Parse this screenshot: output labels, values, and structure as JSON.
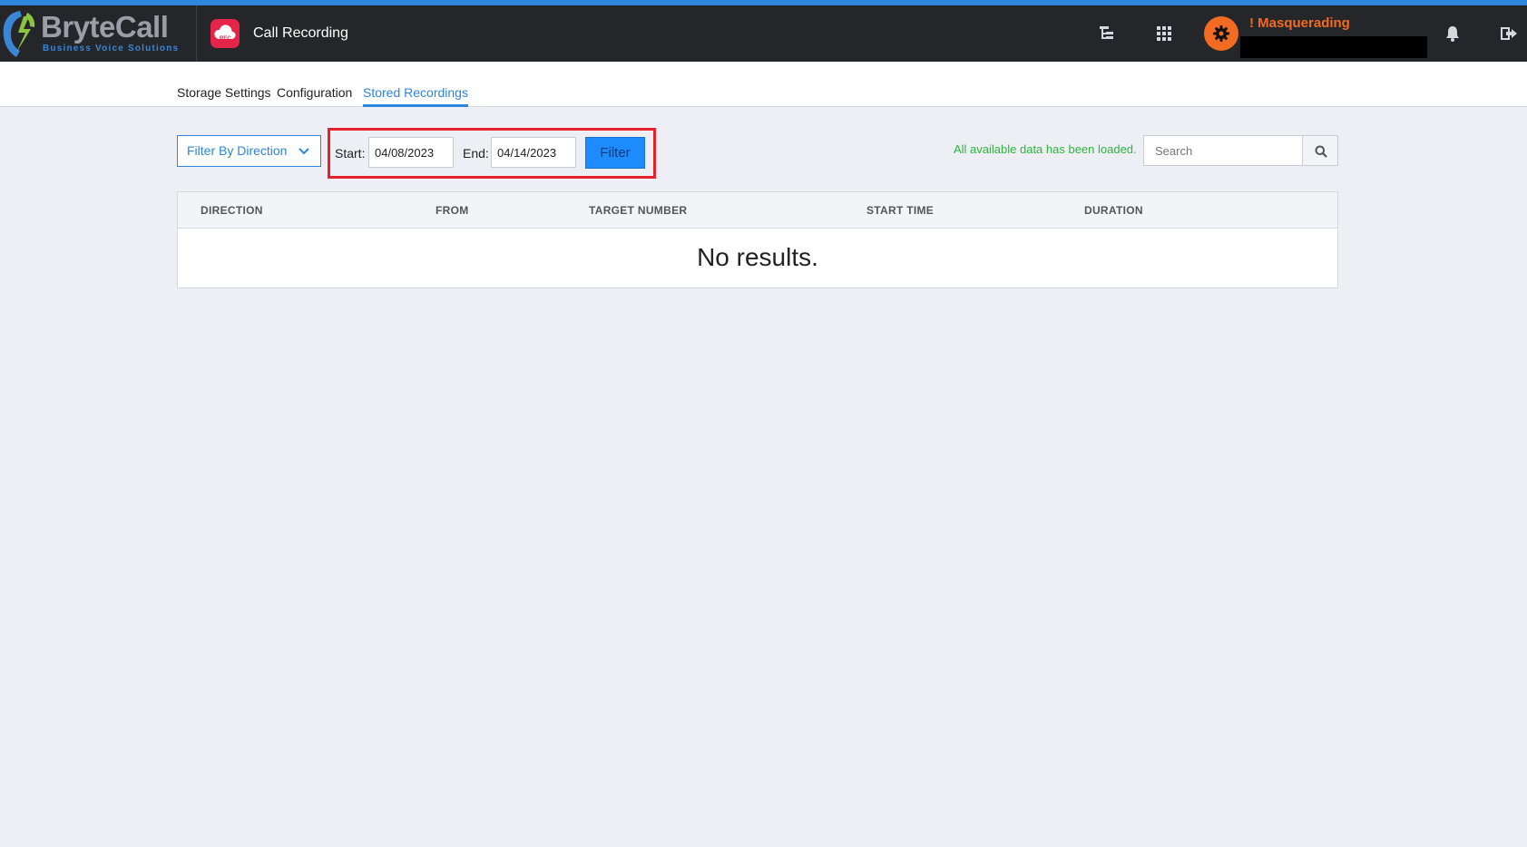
{
  "header": {
    "brand": "BryteCall",
    "brand_tagline": "Business Voice Solutions",
    "app_icon_badge": "REC",
    "app_title": "Call Recording",
    "masquerading_label": "! Masquerading",
    "icons": [
      "org-tree-icon",
      "apps-grid-icon",
      "settings-gear-icon",
      "bell-icon",
      "logout-icon"
    ]
  },
  "nav": {
    "tabs": [
      {
        "label": "Storage Settings",
        "active": false
      },
      {
        "label": "Configuration",
        "active": false
      },
      {
        "label": "Stored Recordings",
        "active": true
      }
    ]
  },
  "controls": {
    "direction_filter_label": "Filter By Direction",
    "start_label": "Start:",
    "start_value": "04/08/2023",
    "end_label": "End:",
    "end_value": "04/14/2023",
    "filter_button": "Filter",
    "status_text": "All available data has been loaded.",
    "search_placeholder": "Search"
  },
  "table": {
    "columns": [
      "DIRECTION",
      "FROM",
      "TARGET NUMBER",
      "START TIME",
      "DURATION"
    ],
    "empty_text": "No results."
  },
  "colors": {
    "accent": "#2d86db",
    "header_bg": "#25262a",
    "masquerade": "#f26b21",
    "app_icon": "#e5244a",
    "status_ok": "#2db53d",
    "highlight": "#e5222a"
  }
}
